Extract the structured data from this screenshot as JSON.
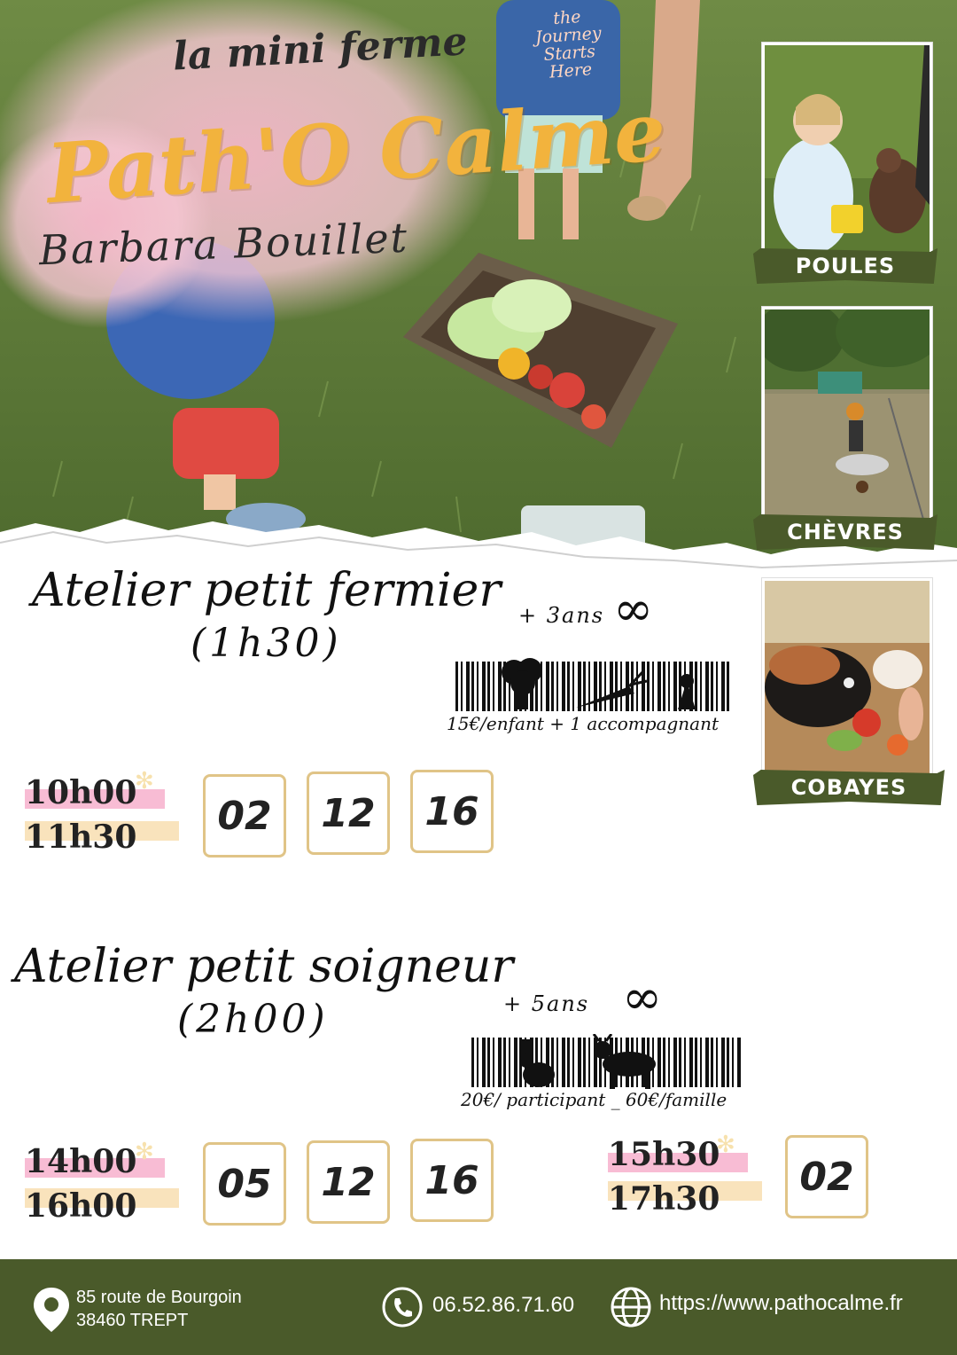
{
  "header": {
    "subtitle": "la mini ferme",
    "brand": "Path'O Calme",
    "owner": "Barbara Bouillet",
    "shirt_text": "the Journey Starts Here"
  },
  "animals": [
    {
      "label": "POULES"
    },
    {
      "label": "CHÈVRES"
    },
    {
      "label": "COBAYES"
    }
  ],
  "atelier1": {
    "title": "Atelier petit fermier",
    "duration": "(1h30)",
    "age": "+ 3ans",
    "infinity": "∞",
    "price": "15€/enfant + 1 accompagnant",
    "start": "10h00",
    "end": "11h30",
    "dates": [
      "02",
      "12",
      "16"
    ]
  },
  "atelier2": {
    "title": "Atelier petit soigneur",
    "duration": "(2h00)",
    "age": "+ 5ans",
    "infinity": "∞",
    "price": "20€/ participant _ 60€/famille",
    "session1": {
      "start": "14h00",
      "end": "16h00",
      "dates": [
        "05",
        "12",
        "16"
      ]
    },
    "session2": {
      "start": "15h30",
      "end": "17h30",
      "dates": [
        "02"
      ]
    }
  },
  "footer": {
    "address_line1": "85 route de Bourgoin",
    "address_line2": "38460 TREPT",
    "phone": "06.52.86.71.60",
    "website": "https://www.pathocalme.fr"
  },
  "colors": {
    "brand_yellow": "#f2b33d",
    "olive": "#4a5a2a",
    "pink_highlight": "#f6a6c5",
    "date_border": "#e0c487"
  }
}
